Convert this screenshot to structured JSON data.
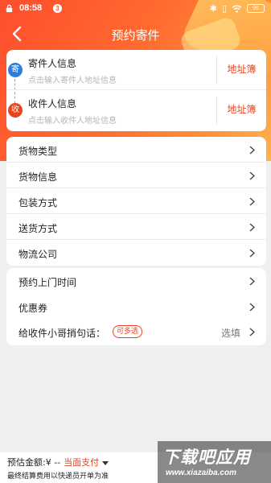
{
  "status_bar": {
    "time": "08:58",
    "notification_count": "3",
    "battery": "96"
  },
  "nav": {
    "title": "预约寄件"
  },
  "sender": {
    "badge": "寄",
    "title": "寄件人信息",
    "placeholder": "点击输入寄件人地址信息",
    "book": "地址簿"
  },
  "receiver": {
    "badge": "收",
    "title": "收件人信息",
    "placeholder": "点击输入收件人地址信息",
    "book": "地址簿"
  },
  "section1": [
    {
      "label": "货物类型"
    },
    {
      "label": "货物信息"
    },
    {
      "label": "包装方式"
    },
    {
      "label": "送货方式"
    },
    {
      "label": "物流公司"
    }
  ],
  "section2": {
    "pickup_time": "预约上门时间",
    "coupon": "优惠券",
    "message_label": "给收件小哥捎句话：",
    "message_tag": "可多选",
    "message_hint": "选填"
  },
  "footer": {
    "estimate": "预估金额:¥ --",
    "payment": "当面支付",
    "note": "最终结算费用以快递员开单为准"
  },
  "watermark": {
    "main": "下载吧应用",
    "url": "www.xiazaiba.com"
  },
  "colors": {
    "accent": "#e8451f",
    "header_start": "#ff4d2e",
    "header_end": "#ffb24a",
    "sender_badge": "#2f7fd6",
    "receiver_badge": "#e8451f"
  }
}
